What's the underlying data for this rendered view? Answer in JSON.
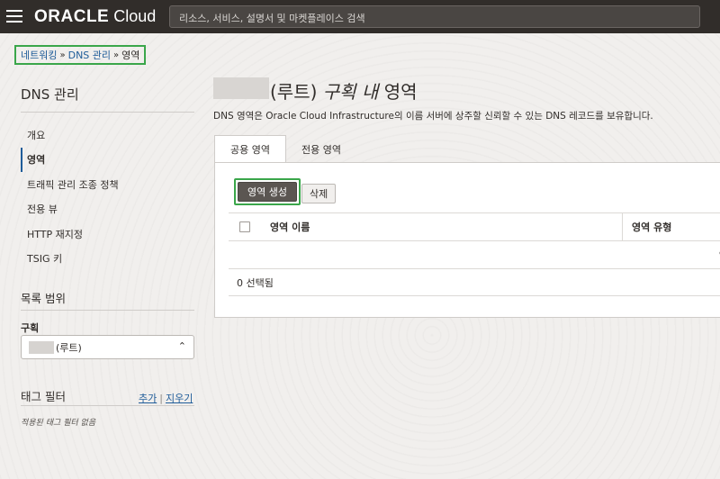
{
  "topbar": {
    "logo_oracle": "ORACLE",
    "logo_cloud": "Cloud",
    "search_placeholder": "리소스, 서비스, 설명서 및 마켓플레이스 검색"
  },
  "breadcrumb": {
    "items": [
      "네트워킹",
      "DNS 관리"
    ],
    "current": "영역",
    "separator": "»"
  },
  "sidebar": {
    "title": "DNS 관리",
    "items": [
      "개요",
      "영역",
      "트래픽 관리 조종 정책",
      "전용 뷰",
      "HTTP 재지정",
      "TSIG 키"
    ],
    "active_index": 1,
    "scope_title": "목록 범위",
    "compartment_label": "구획",
    "compartment_value": "(루트)",
    "tag_filter_title": "태그 필터",
    "tag_add": "추가",
    "tag_clear": "지우기",
    "tag_none": "적용된 태그 필터 없음"
  },
  "main": {
    "title_prefix": "(루트)",
    "title_italic": "구획 내",
    "title_suffix": "영역",
    "description": "DNS 영역은 Oracle Cloud Infrastructure의 이름 서버에 상주할 신뢰할 수 있는 DNS 레코드를 보유합니다.",
    "tabs": [
      "공용 영역",
      "전용 영역"
    ],
    "active_tab": 0,
    "create_button": "영역 생성",
    "delete_button": "삭제",
    "columns": [
      "영역 이름",
      "영역 유형"
    ],
    "empty_text": "영",
    "selected_count": "0 선택됨"
  },
  "colors": {
    "topbar": "#312d2a",
    "link": "#1f5c99",
    "highlight": "#3aa64a",
    "primary_button": "#5b5652"
  }
}
